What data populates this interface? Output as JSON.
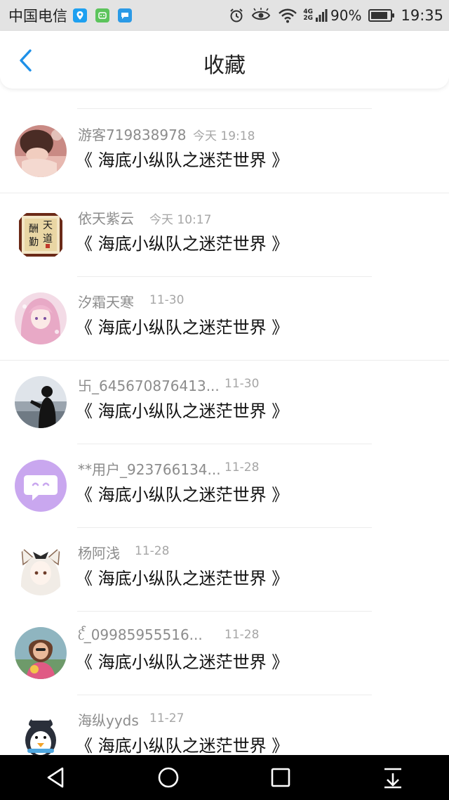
{
  "status_bar": {
    "carrier": "中国电信",
    "network_top": "4G",
    "network_bottom": "2G",
    "battery": "90%",
    "battery_level": 0.9,
    "time": "19:35",
    "icons": [
      "location-pin-icon",
      "app-notification-icon",
      "chat-bubble-icon",
      "alarm-icon",
      "eye-icon",
      "wifi-icon",
      "signal-icon",
      "battery-icon"
    ]
  },
  "header": {
    "title": "收藏",
    "back_icon": "chevron-left-icon"
  },
  "list": {
    "top_fragment": "...",
    "items": [
      {
        "username": "游客719838978",
        "time": "今天 19:18",
        "title": "《 海底小纵队之迷茫世界 》",
        "avatar": "girl-pink-avatar"
      },
      {
        "username": "依天紫云",
        "time": "今天 10:17",
        "title": "《 海底小纵队之迷茫世界 》",
        "avatar": "calligraphy-avatar"
      },
      {
        "username": "汐霜天寒",
        "time": "11-30",
        "title": "《 海底小纵队之迷茫世界 》",
        "avatar": "anime-pink-hair-avatar"
      },
      {
        "username": "卐_645670876413...",
        "time": "11-30",
        "title": "《 海底小纵队之迷茫世界 》",
        "avatar": "silhouette-sea-avatar"
      },
      {
        "username": "**用户_923766134...",
        "time": "11-28",
        "title": "《 海底小纵队之迷茫世界 》",
        "avatar": "purple-chat-avatar"
      },
      {
        "username": "杨阿浅",
        "time": "11-28",
        "title": "《 海底小纵队之迷茫世界 》",
        "avatar": "anime-cat-ear-avatar"
      },
      {
        "username": "ᦷᩘ_09985955516...",
        "time": "11-28",
        "title": "《 海底小纵队之迷茫世界 》",
        "avatar": "cartoon-girl-avatar"
      },
      {
        "username": "海纵yyds",
        "time": "11-27",
        "title": "《 海底小纵队之迷茫世界 》",
        "avatar": "penguin-avatar"
      }
    ]
  },
  "nav_bar": {
    "buttons": [
      "back-triangle-icon",
      "home-circle-icon",
      "recents-square-icon",
      "notification-pulldown-icon"
    ]
  },
  "colors": {
    "accent": "#1e90e8",
    "status_bar_bg": "#e3e3e3",
    "username_text": "#8c8c8c",
    "time_text": "#a6a6a6",
    "title_text": "#111111",
    "nav_bar_bg": "#000000"
  }
}
